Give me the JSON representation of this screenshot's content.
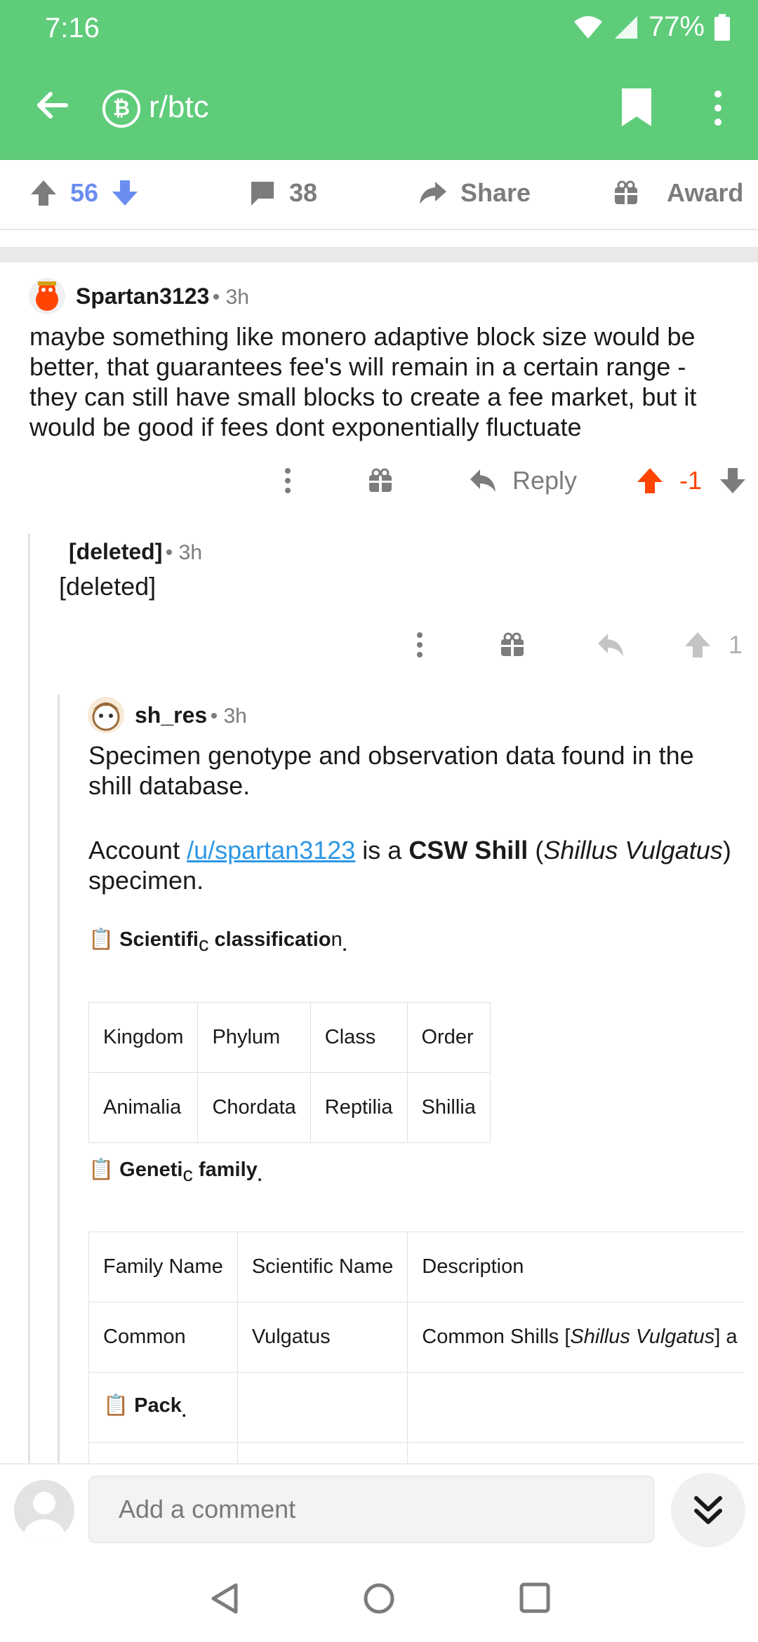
{
  "status": {
    "time": "7:16",
    "battery": "77%"
  },
  "app_bar": {
    "subreddit": "r/btc",
    "sub_icon_glyph": "₿"
  },
  "post_actions": {
    "score": "56",
    "comments": "38",
    "share": "Share",
    "award": "Award"
  },
  "comments": [
    {
      "author": "Spartan3123",
      "time": "3h",
      "body": "maybe something like monero adaptive block size would be better, that guarantees fee's will remain in a certain range - they can still have small blocks to create a fee market, but it would be good if fees dont exponentially fluctuate",
      "reply_label": "Reply",
      "score": "-1"
    },
    {
      "author": "[deleted]",
      "time": "3h",
      "body": "[deleted]",
      "score": "1"
    },
    {
      "author": "sh_res",
      "time": "3h",
      "intro": "Specimen genotype and observation data found in the shill database.",
      "account_prefix": "Account ",
      "account_link": "/u/spartan3123",
      "account_mid": " is a ",
      "account_bold": "CSW Shill",
      "account_paren_open": " (",
      "account_italic": "Shillus Vulgatus",
      "account_paren_close": ")",
      "account_suffix": "specimen.",
      "section1": {
        "icon": "📋",
        "a": "Scientifi",
        "b": "c",
        "c": " classificatio",
        "d": "n",
        "e": "."
      },
      "table1": {
        "headers": [
          "Kingdom",
          "Phylum",
          "Class",
          "Order"
        ],
        "row": [
          "Animalia",
          "Chordata",
          "Reptilia",
          "Shillia"
        ]
      },
      "section2": {
        "icon": "📋",
        "a": "Geneti",
        "b": "c",
        "c": " family",
        "d": "",
        "e": "."
      },
      "table2": {
        "headers": [
          "Family Name",
          "Scientific Name",
          "Description"
        ],
        "row": [
          "Common",
          "Vulgatus"
        ],
        "desc_prefix": "Common Shills [",
        "desc_italic": "Shillus Vulgatus",
        "desc_suffix": "] a",
        "pack_icon": "📋",
        "pack_label": "Pack",
        "pack_dot": "."
      }
    }
  ],
  "composer": {
    "placeholder": "Add a comment"
  },
  "colors": {
    "brand_green": "#5fcc7a",
    "upvote_blue": "#6a8ef0",
    "downvote_orange": "#ff4500",
    "link_blue": "#2d97e5"
  }
}
